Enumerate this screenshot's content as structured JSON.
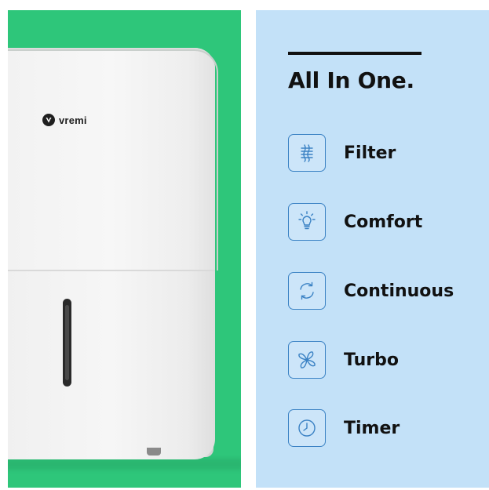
{
  "product": {
    "brand": "vremi",
    "brand_icon": "vremi-logo-icon",
    "panel_color": "#2ec67a"
  },
  "features_panel": {
    "heading": "All In One.",
    "panel_color": "#c3e1f8",
    "icon_color": "#3b82c4",
    "items": [
      {
        "label": "Filter",
        "icon": "filter-icon"
      },
      {
        "label": "Comfort",
        "icon": "lightbulb-icon"
      },
      {
        "label": "Continuous",
        "icon": "cycle-arrows-icon"
      },
      {
        "label": "Turbo",
        "icon": "fan-icon"
      },
      {
        "label": "Timer",
        "icon": "clock-icon"
      }
    ]
  }
}
